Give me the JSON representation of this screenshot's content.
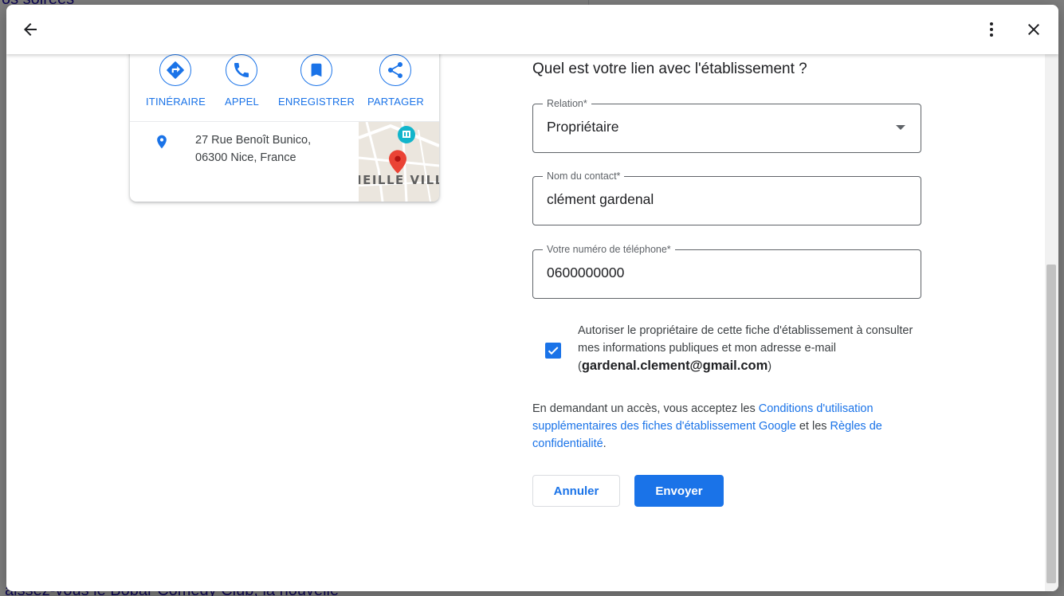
{
  "background_page": {
    "fragments": [
      "os soirées",
      "aissez-vous le Bobar Comedy Club, la nouvelle"
    ]
  },
  "header": {
    "back_icon": "arrow-back-icon",
    "more_icon": "more-vert-icon",
    "close_icon": "close-icon"
  },
  "card": {
    "actions": [
      {
        "label": "ITINÉRAIRE",
        "icon": "directions-icon"
      },
      {
        "label": "APPEL",
        "icon": "phone-icon"
      },
      {
        "label": "ENREGISTRER",
        "icon": "bookmark-icon"
      },
      {
        "label": "PARTAGER",
        "icon": "share-icon"
      }
    ],
    "address_line1": "27 Rue Benoît Bunico,",
    "address_line2": "06300 Nice, France",
    "map_label": "IEILLE VILL"
  },
  "form": {
    "title": "Quel est votre lien avec l'établissement ?",
    "relation": {
      "label": "Relation*",
      "value": "Propriétaire"
    },
    "contact": {
      "label": "Nom du contact*",
      "value": "clément gardenal"
    },
    "phone": {
      "label": "Votre numéro de téléphone*",
      "value": "0600000000"
    },
    "consent": {
      "checked": true,
      "text": "Autoriser le propriétaire de cette fiche d'établissement à consulter mes informations publiques et mon adresse e-mail",
      "email": "gardenal.clement@gmail.com",
      "open_paren": "(",
      "close_paren": ")"
    },
    "terms": {
      "prefix": "En demandant un accès, vous acceptez les ",
      "link1": "Conditions d'utilisation supplémentaires des fiches d'établissement Google",
      "middle": " et les ",
      "link2": "Règles de confidentialité",
      "suffix": "."
    },
    "cancel_label": "Annuler",
    "send_label": "Envoyer"
  },
  "colors": {
    "accent": "#1a73e8",
    "pin_red": "#ea4335"
  }
}
